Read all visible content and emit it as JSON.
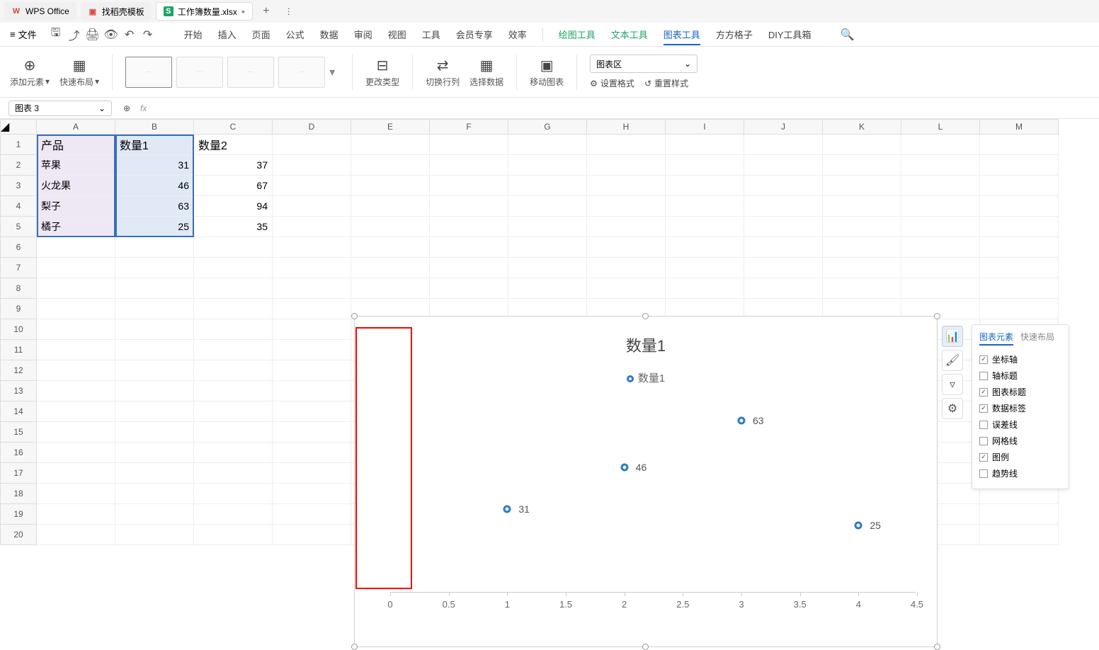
{
  "tabs": {
    "wps": "WPS Office",
    "rice": "找稻壳模板",
    "file": "工作簿数量.xlsx"
  },
  "menu": {
    "file": "文件",
    "start": "开始",
    "insert": "插入",
    "page": "页面",
    "formula": "公式",
    "data": "数据",
    "review": "审阅",
    "view": "视图",
    "tools": "工具",
    "member": "会员专享",
    "efficiency": "效率",
    "draw": "绘图工具",
    "text": "文本工具",
    "chart": "图表工具",
    "square": "方方格子",
    "diy": "DIY工具箱"
  },
  "ribbon": {
    "addElement": "添加元素",
    "quickLayout": "快速布局",
    "changeType": "更改类型",
    "switchRC": "切换行列",
    "selectData": "选择数据",
    "moveChart": "移动图表",
    "setFormat": "设置格式",
    "resetStyle": "重置样式",
    "areaSelect": "图表区"
  },
  "nameBox": "图表 3",
  "cols": [
    "A",
    "B",
    "C",
    "D",
    "E",
    "F",
    "G",
    "H",
    "I",
    "J",
    "K",
    "L",
    "M"
  ],
  "headers": {
    "A": "产品",
    "B": "数量1",
    "C": "数量2"
  },
  "dataRows": [
    {
      "A": "苹果",
      "B": 31,
      "C": 37
    },
    {
      "A": "火龙果",
      "B": 46,
      "C": 67
    },
    {
      "A": "梨子",
      "B": 63,
      "C": 94
    },
    {
      "A": "橘子",
      "B": 25,
      "C": 35
    }
  ],
  "chart_data": {
    "type": "scatter",
    "title": "数量1",
    "legend": "数量1",
    "x": [
      1,
      2,
      3,
      4
    ],
    "y": [
      31,
      46,
      63,
      25
    ],
    "labels": [
      "31",
      "46",
      "63",
      "25"
    ],
    "xticks": [
      "0",
      "0.5",
      "1",
      "1.5",
      "2",
      "2.5",
      "3",
      "3.5",
      "4",
      "4.5"
    ],
    "xlim": [
      0,
      4.5
    ]
  },
  "panel": {
    "tabElem": "图表元素",
    "tabQuick": "快速布局",
    "axis": "坐标轴",
    "axisTitle": "轴标题",
    "chartTitle": "图表标题",
    "dataLabel": "数据标签",
    "errorBar": "误差线",
    "grid": "网格线",
    "legend": "图例",
    "trend": "趋势线"
  }
}
